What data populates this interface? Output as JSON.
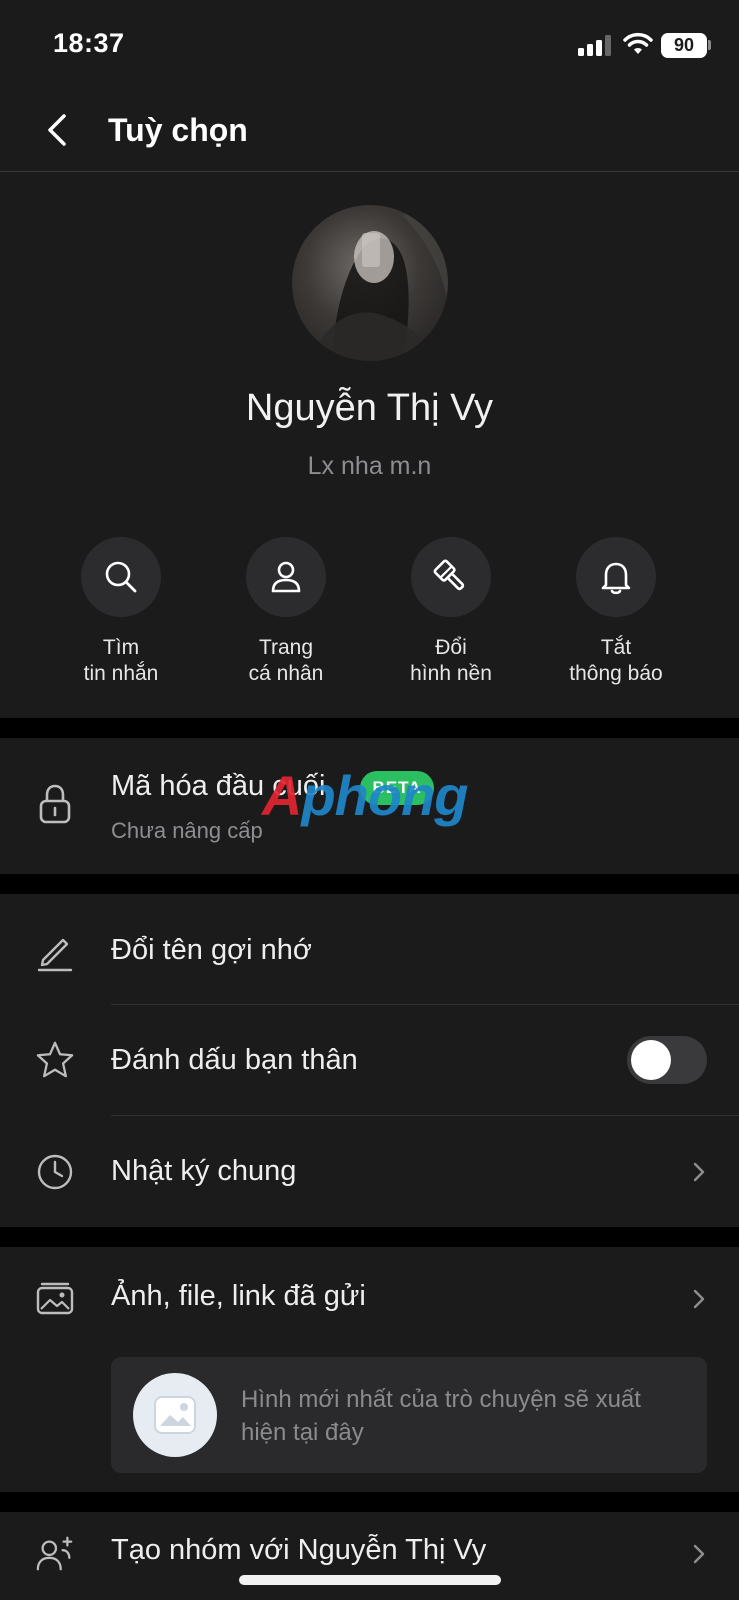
{
  "status_bar": {
    "time": "18:37",
    "battery": "90"
  },
  "header": {
    "title": "Tuỳ chọn"
  },
  "profile": {
    "name": "Nguyễn Thị Vy",
    "status": "Lx nha m.n"
  },
  "actions": [
    {
      "line1": "Tìm",
      "line2": "tin nhắn",
      "icon": "search-icon"
    },
    {
      "line1": "Trang",
      "line2": "cá nhân",
      "icon": "person-icon"
    },
    {
      "line1": "Đổi",
      "line2": "hình nền",
      "icon": "paint-brush-icon"
    },
    {
      "line1": "Tắt",
      "line2": "thông báo",
      "icon": "bell-icon"
    }
  ],
  "encryption": {
    "label": "Mã hóa đầu cuối",
    "badge": "BETA",
    "sublabel": "Chưa nâng cấp",
    "watermark_a": "A",
    "watermark_rest": "phong"
  },
  "settings": {
    "rename": "Đổi tên gợi nhớ",
    "best_friend": "Đánh dấu bạn thân",
    "best_friend_on": false,
    "shared_diary": "Nhật ký chung"
  },
  "media": {
    "label": "Ảnh, file, link đã gửi",
    "placeholder": "Hình mới nhất của trò chuyện sẽ xuất hiện tại đây"
  },
  "create_group": {
    "label": "Tạo nhóm với Nguyễn Thị Vy"
  },
  "colors": {
    "background": "#1b1b1c",
    "separator": "#000000",
    "accent_badge": "#2bbf62"
  }
}
